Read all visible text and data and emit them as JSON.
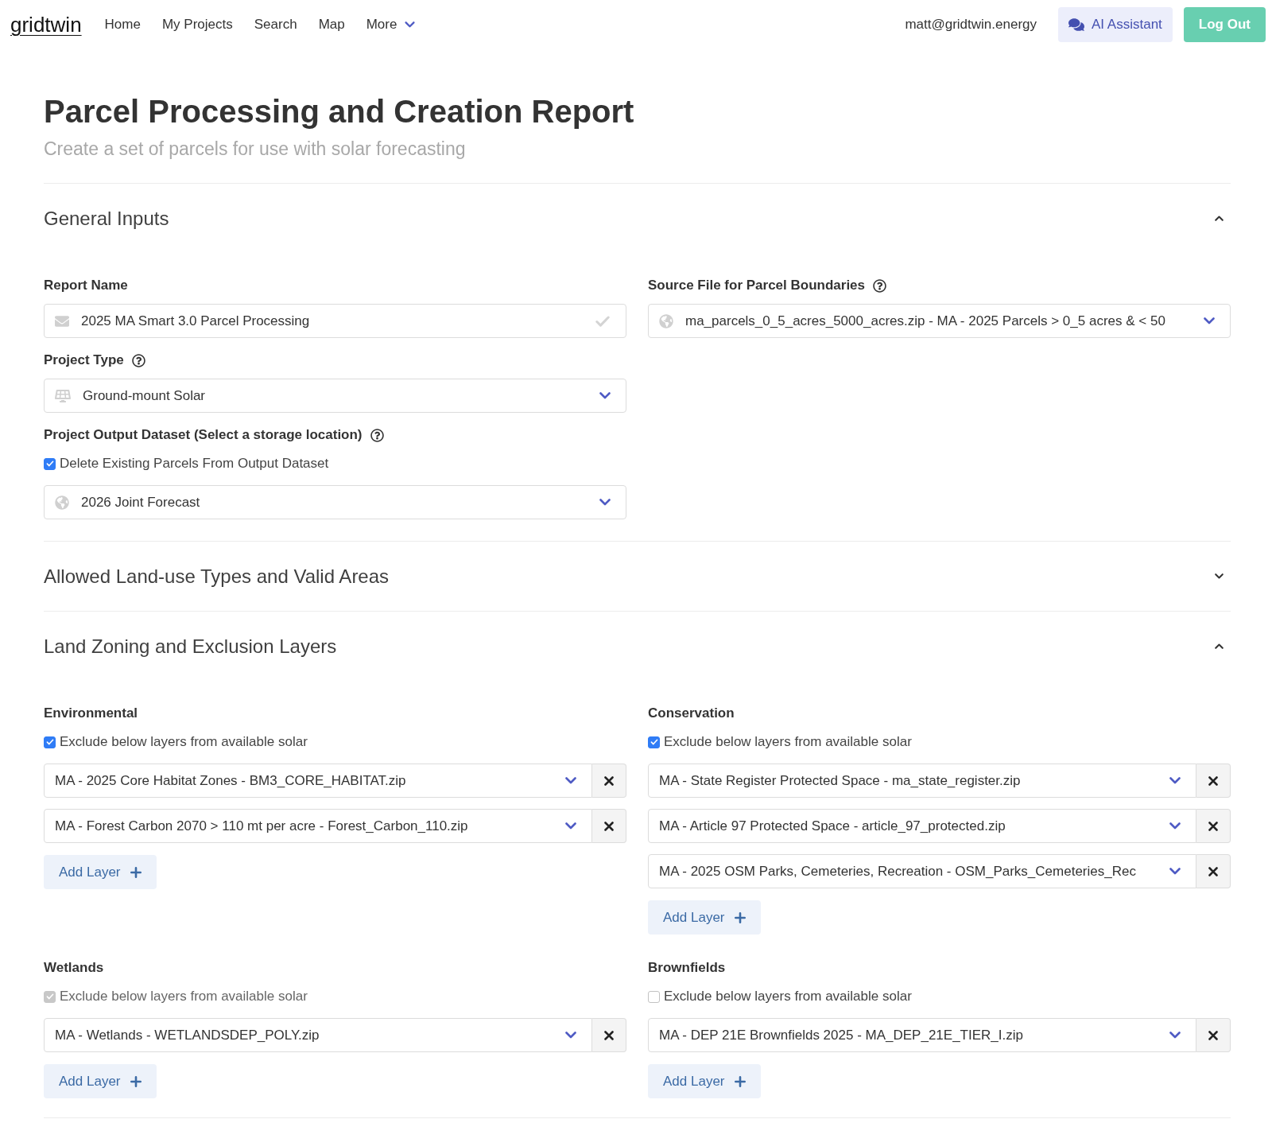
{
  "nav": {
    "logo": "gridtwin",
    "links": [
      "Home",
      "My Projects",
      "Search",
      "Map"
    ],
    "more": "More",
    "user": "matt@gridtwin.energy",
    "assistant_button": "AI Assistant",
    "logout_button": "Log Out"
  },
  "header": {
    "title": "Parcel Processing and Creation Report",
    "subtitle": "Create a set of parcels for use with solar forecasting"
  },
  "general_inputs": {
    "title": "General Inputs",
    "expanded": true,
    "report_name": {
      "label": "Report Name",
      "value": "2025 MA Smart 3.0 Parcel Processing"
    },
    "project_type": {
      "label": "Project Type",
      "value": "Ground-mount Solar"
    },
    "output_dataset": {
      "label": "Project Output Dataset (Select a storage location)",
      "delete_existing": {
        "label": "Delete Existing Parcels From Output Dataset",
        "checked": true
      },
      "value": "2026 Joint Forecast"
    },
    "source_file": {
      "label": "Source File for Parcel Boundaries",
      "value": "ma_parcels_0_5_acres_5000_acres.zip - MA - 2025 Parcels > 0_5 acres & < 50"
    }
  },
  "land_use": {
    "title": "Allowed Land-use Types and Valid Areas",
    "expanded": false
  },
  "zoning": {
    "title": "Land Zoning and Exclusion Layers",
    "expanded": true,
    "groups": [
      {
        "title": "Environmental",
        "exclude": {
          "label": "Exclude below layers from available solar",
          "checked": true,
          "disabled": false
        },
        "layers": [
          "MA - 2025 Core Habitat Zones - BM3_CORE_HABITAT.zip",
          "MA - Forest Carbon 2070 > 110 mt per acre - Forest_Carbon_110.zip"
        ],
        "add_button": "Add Layer"
      },
      {
        "title": "Conservation",
        "exclude": {
          "label": "Exclude below layers from available solar",
          "checked": true,
          "disabled": false
        },
        "layers": [
          "MA - State Register Protected Space - ma_state_register.zip",
          "MA - Article 97 Protected Space - article_97_protected.zip",
          "MA - 2025 OSM Parks, Cemeteries, Recreation - OSM_Parks_Cemeteries_Rec"
        ],
        "add_button": "Add Layer"
      },
      {
        "title": "Wetlands",
        "exclude": {
          "label": "Exclude below layers from available solar",
          "checked": true,
          "disabled": true
        },
        "layers": [
          "MA - Wetlands - WETLANDSDEP_POLY.zip"
        ],
        "add_button": "Add Layer"
      },
      {
        "title": "Brownfields",
        "exclude": {
          "label": "Exclude below layers from available solar",
          "checked": false,
          "disabled": false
        },
        "layers": [
          "MA - DEP 21E Brownfields 2025 - MA_DEP_21E_TIER_I.zip"
        ],
        "add_button": "Add Layer"
      }
    ]
  }
}
